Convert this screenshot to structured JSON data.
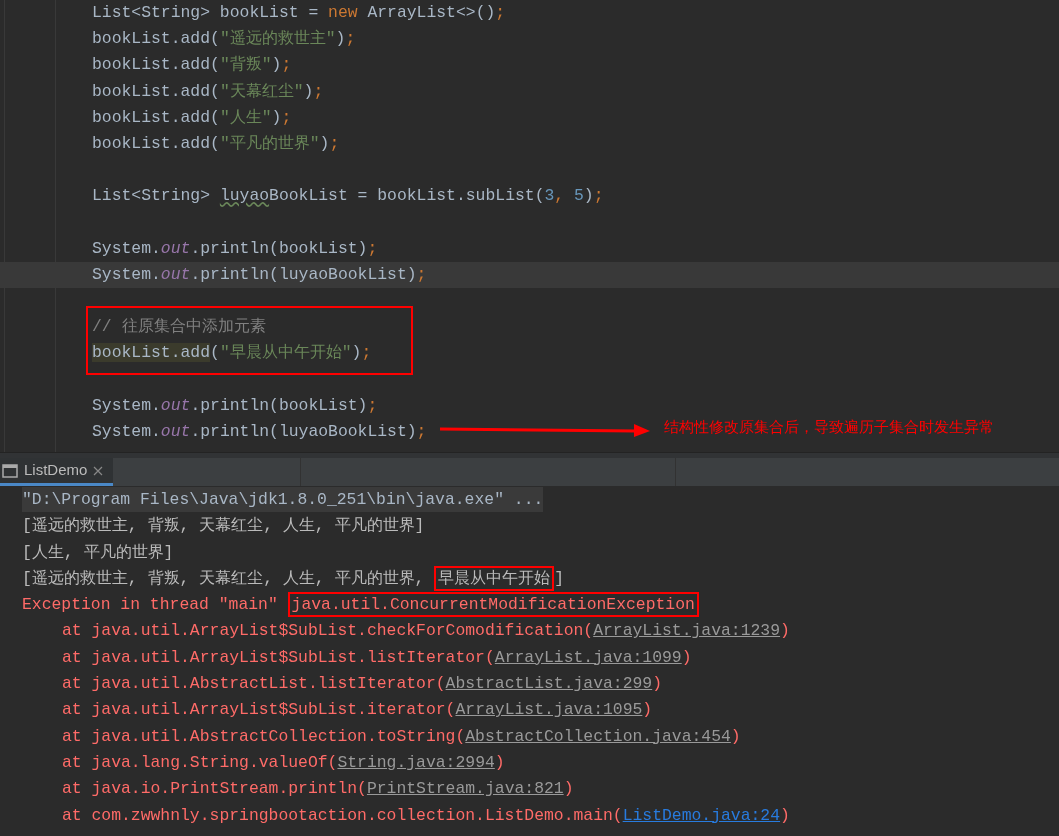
{
  "editor": {
    "lines": [
      {
        "current": false,
        "boxed": false,
        "tokens": [
          {
            "kind": "plain",
            "text": "List<String> bookList = "
          },
          {
            "kind": "keyword",
            "text": "new"
          },
          {
            "kind": "plain",
            "text": " ArrayList<>()"
          },
          {
            "kind": "punct",
            "text": ";"
          }
        ]
      },
      {
        "current": false,
        "boxed": false,
        "tokens": [
          {
            "kind": "plain",
            "text": "bookList.add("
          },
          {
            "kind": "string",
            "text": "\"遥远的救世主\""
          },
          {
            "kind": "plain",
            "text": ")"
          },
          {
            "kind": "punct",
            "text": ";"
          }
        ]
      },
      {
        "current": false,
        "boxed": false,
        "tokens": [
          {
            "kind": "plain",
            "text": "bookList.add("
          },
          {
            "kind": "string",
            "text": "\"背叛\""
          },
          {
            "kind": "plain",
            "text": ")"
          },
          {
            "kind": "punct",
            "text": ";"
          }
        ]
      },
      {
        "current": false,
        "boxed": false,
        "tokens": [
          {
            "kind": "plain",
            "text": "bookList.add("
          },
          {
            "kind": "string",
            "text": "\"天幕红尘\""
          },
          {
            "kind": "plain",
            "text": ")"
          },
          {
            "kind": "punct",
            "text": ";"
          }
        ]
      },
      {
        "current": false,
        "boxed": false,
        "tokens": [
          {
            "kind": "plain",
            "text": "bookList.add("
          },
          {
            "kind": "string",
            "text": "\"人生\""
          },
          {
            "kind": "plain",
            "text": ")"
          },
          {
            "kind": "punct",
            "text": ";"
          }
        ]
      },
      {
        "current": false,
        "boxed": false,
        "tokens": [
          {
            "kind": "plain",
            "text": "bookList.add("
          },
          {
            "kind": "string",
            "text": "\"平凡的世界\""
          },
          {
            "kind": "plain",
            "text": ")"
          },
          {
            "kind": "punct",
            "text": ";"
          }
        ]
      },
      {
        "current": false,
        "boxed": false
      },
      {
        "current": false,
        "boxed": false,
        "tokens": [
          {
            "kind": "plain",
            "text": "List<String> "
          },
          {
            "kind": "warning",
            "text": "luyao"
          },
          {
            "kind": "plain",
            "text": "BookList = bookList.subList("
          },
          {
            "kind": "number",
            "text": "3"
          },
          {
            "kind": "punct",
            "text": ", "
          },
          {
            "kind": "number",
            "text": "5"
          },
          {
            "kind": "plain",
            "text": ")"
          },
          {
            "kind": "punct",
            "text": ";"
          }
        ]
      },
      {
        "current": false,
        "boxed": false
      },
      {
        "current": false,
        "boxed": false,
        "tokens": [
          {
            "kind": "plain",
            "text": "System."
          },
          {
            "kind": "static",
            "text": "out"
          },
          {
            "kind": "plain",
            "text": ".println(bookList)"
          },
          {
            "kind": "punct",
            "text": ";"
          }
        ]
      },
      {
        "current": true,
        "boxed": false,
        "tokens": [
          {
            "kind": "plain",
            "text": "System."
          },
          {
            "kind": "static",
            "text": "out"
          },
          {
            "kind": "plain",
            "text": ".println(luyaoBookList)"
          },
          {
            "kind": "punct",
            "text": ";"
          }
        ]
      },
      {
        "current": false,
        "boxed": false
      },
      {
        "current": false,
        "boxed": true,
        "tokens": [
          {
            "kind": "comment",
            "text": "// 往原集合中添加元素"
          }
        ]
      },
      {
        "current": false,
        "boxed": true,
        "tokens": [
          {
            "kind": "usage",
            "text": "bookList.add"
          },
          {
            "kind": "plain",
            "text": "("
          },
          {
            "kind": "string",
            "text": "\"早晨从中午开始\""
          },
          {
            "kind": "plain",
            "text": ")"
          },
          {
            "kind": "punct",
            "text": ";"
          }
        ]
      },
      {
        "current": false,
        "boxed": false
      },
      {
        "current": false,
        "boxed": false,
        "tokens": [
          {
            "kind": "plain",
            "text": "System."
          },
          {
            "kind": "static",
            "text": "out"
          },
          {
            "kind": "plain",
            "text": ".println(bookList)"
          },
          {
            "kind": "punct",
            "text": ";"
          }
        ]
      },
      {
        "current": false,
        "boxed": false,
        "tokens": [
          {
            "kind": "plain",
            "text": "System."
          },
          {
            "kind": "static",
            "text": "out"
          },
          {
            "kind": "plain",
            "text": ".println(luyaoBookList)"
          },
          {
            "kind": "punct",
            "text": ";"
          }
        ]
      }
    ]
  },
  "annotation": {
    "text": "结构性修改原集合后，导致遍历子集合时发生异常"
  },
  "tool_window": {
    "tabs": [
      {
        "label": "ListDemo",
        "selected": true
      }
    ]
  },
  "console": {
    "lines": [
      {
        "kind": "command",
        "segments": [
          {
            "kind": "command",
            "boxed": false,
            "text": "\"D:\\Program Files\\Java\\jdk1.8.0_251\\bin\\java.exe\" ..."
          }
        ]
      },
      {
        "kind": "output",
        "segments": [
          {
            "kind": "output",
            "boxed": false,
            "text": "[遥远的救世主, 背叛, 天幕红尘, 人生, 平凡的世界]"
          }
        ]
      },
      {
        "kind": "output",
        "segments": [
          {
            "kind": "output",
            "boxed": false,
            "text": "[人生, 平凡的世界]"
          }
        ]
      },
      {
        "kind": "output",
        "segments": [
          {
            "kind": "output",
            "boxed": false,
            "text": "[遥远的救世主, 背叛, 天幕红尘, 人生, 平凡的世界, "
          },
          {
            "kind": "output",
            "boxed": true,
            "text": "早晨从中午开始"
          },
          {
            "kind": "output",
            "boxed": false,
            "text": "]"
          }
        ]
      },
      {
        "kind": "error",
        "segments": [
          {
            "kind": "error",
            "boxed": false,
            "text": "Exception in thread \"main\" "
          },
          {
            "kind": "error",
            "boxed": true,
            "text": "java.util.ConcurrentModificationException"
          }
        ]
      },
      {
        "kind": "frame",
        "segments": [
          {
            "kind": "error",
            "boxed": false,
            "text": "at java.util.ArrayList$SubList.checkForComodification("
          },
          {
            "kind": "link",
            "boxed": false,
            "text": "ArrayList.java:1239"
          },
          {
            "kind": "error",
            "boxed": false,
            "text": ")"
          }
        ]
      },
      {
        "kind": "frame",
        "segments": [
          {
            "kind": "error",
            "boxed": false,
            "text": "at java.util.ArrayList$SubList.listIterator("
          },
          {
            "kind": "link",
            "boxed": false,
            "text": "ArrayList.java:1099"
          },
          {
            "kind": "error",
            "boxed": false,
            "text": ")"
          }
        ]
      },
      {
        "kind": "frame",
        "segments": [
          {
            "kind": "error",
            "boxed": false,
            "text": "at java.util.AbstractList.listIterator("
          },
          {
            "kind": "link",
            "boxed": false,
            "text": "AbstractList.java:299"
          },
          {
            "kind": "error",
            "boxed": false,
            "text": ")"
          }
        ]
      },
      {
        "kind": "frame",
        "segments": [
          {
            "kind": "error",
            "boxed": false,
            "text": "at java.util.ArrayList$SubList.iterator("
          },
          {
            "kind": "link",
            "boxed": false,
            "text": "ArrayList.java:1095"
          },
          {
            "kind": "error",
            "boxed": false,
            "text": ")"
          }
        ]
      },
      {
        "kind": "frame",
        "segments": [
          {
            "kind": "error",
            "boxed": false,
            "text": "at java.util.AbstractCollection.toString("
          },
          {
            "kind": "link",
            "boxed": false,
            "text": "AbstractCollection.java:454"
          },
          {
            "kind": "error",
            "boxed": false,
            "text": ")"
          }
        ]
      },
      {
        "kind": "frame",
        "segments": [
          {
            "kind": "error",
            "boxed": false,
            "text": "at java.lang.String.valueOf("
          },
          {
            "kind": "link",
            "boxed": false,
            "text": "String.java:2994"
          },
          {
            "kind": "error",
            "boxed": false,
            "text": ")"
          }
        ]
      },
      {
        "kind": "frame",
        "segments": [
          {
            "kind": "error",
            "boxed": false,
            "text": "at java.io.PrintStream.println("
          },
          {
            "kind": "link",
            "boxed": false,
            "text": "PrintStream.java:821"
          },
          {
            "kind": "error",
            "boxed": false,
            "text": ")"
          }
        ]
      },
      {
        "kind": "frame",
        "segments": [
          {
            "kind": "error",
            "boxed": false,
            "text": "at com.zwwhnly.springbootaction.collection.ListDemo.main("
          },
          {
            "kind": "user_link",
            "boxed": false,
            "text": "ListDemo.java:24"
          },
          {
            "kind": "error",
            "boxed": false,
            "text": ")"
          }
        ]
      }
    ]
  }
}
